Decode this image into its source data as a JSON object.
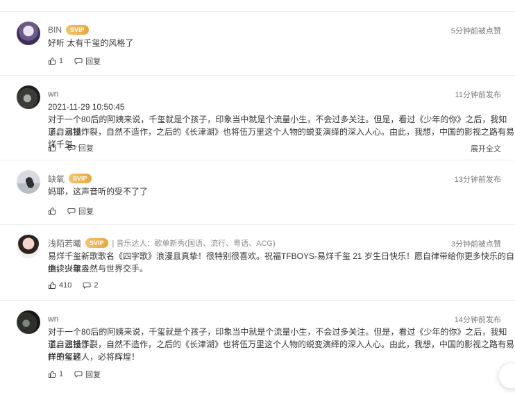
{
  "comments": [
    {
      "name": "BIN",
      "svip": "SVIP",
      "time": "5分钟前被点赞",
      "text": "好听 太有千玺的风格了",
      "likes": "1",
      "reply_label": "回复"
    },
    {
      "name": "wn",
      "time": "11分钟前发布",
      "date": "2021-11-29 10:50:45",
      "text_lines": [
        "对于一个80后的阿姨来说，千玺就是个孩子，印象当中就是个流量小生，不会过多关注。但是，看过《少年的你》之后，我知道自己错",
        "了。演技炸裂，自然不造作，之后的《长津湖》也将伍万里这个人物的蜕变演绎的深入人心。由此，我想，中国的影视之路有易烊千玺..."
      ],
      "reply_label": "回复",
      "expand_label": "展开全文"
    },
    {
      "name": "缺氧",
      "svip": "SVIP",
      "time": "13分钟前发布",
      "text": "妈耶，这声音听的受不了了",
      "reply_label": "回复"
    },
    {
      "name": "浅陌若曦",
      "svip": "SVIP",
      "extra": "| 音乐达人：歌单新秀(国语、流行、粤语、ACG)",
      "time": "3分钟前被点赞",
      "text_lines": [
        "易烊千玺新歌歌名《四字歌》浪漫且真挚！很特别很喜欢。祝福TFBOYS-易烊千玺 21 岁生日快乐！愿自律带给你更多快乐的自由，少年",
        "继续兴致盎然与世界交手。"
      ],
      "likes": "410",
      "replies": "2"
    },
    {
      "name": "wn",
      "time": "14分钟前发布",
      "text_lines": [
        "对于一个80后的阿姨来说，千玺就是个孩子，印象当中就是个流量小生，不会过多关注。但是，看过《少年的你》之后，我知道自己错了。",
        "了。演技炸裂，自然不造作，之后的《长津湖》也将伍万里这个人物的蜕变演绎的深入人心。由此，我想，中国的影视之路有易烊千玺这",
        "样的年轻人，必将辉煌！"
      ],
      "likes": "1",
      "reply_label": "回复"
    }
  ]
}
